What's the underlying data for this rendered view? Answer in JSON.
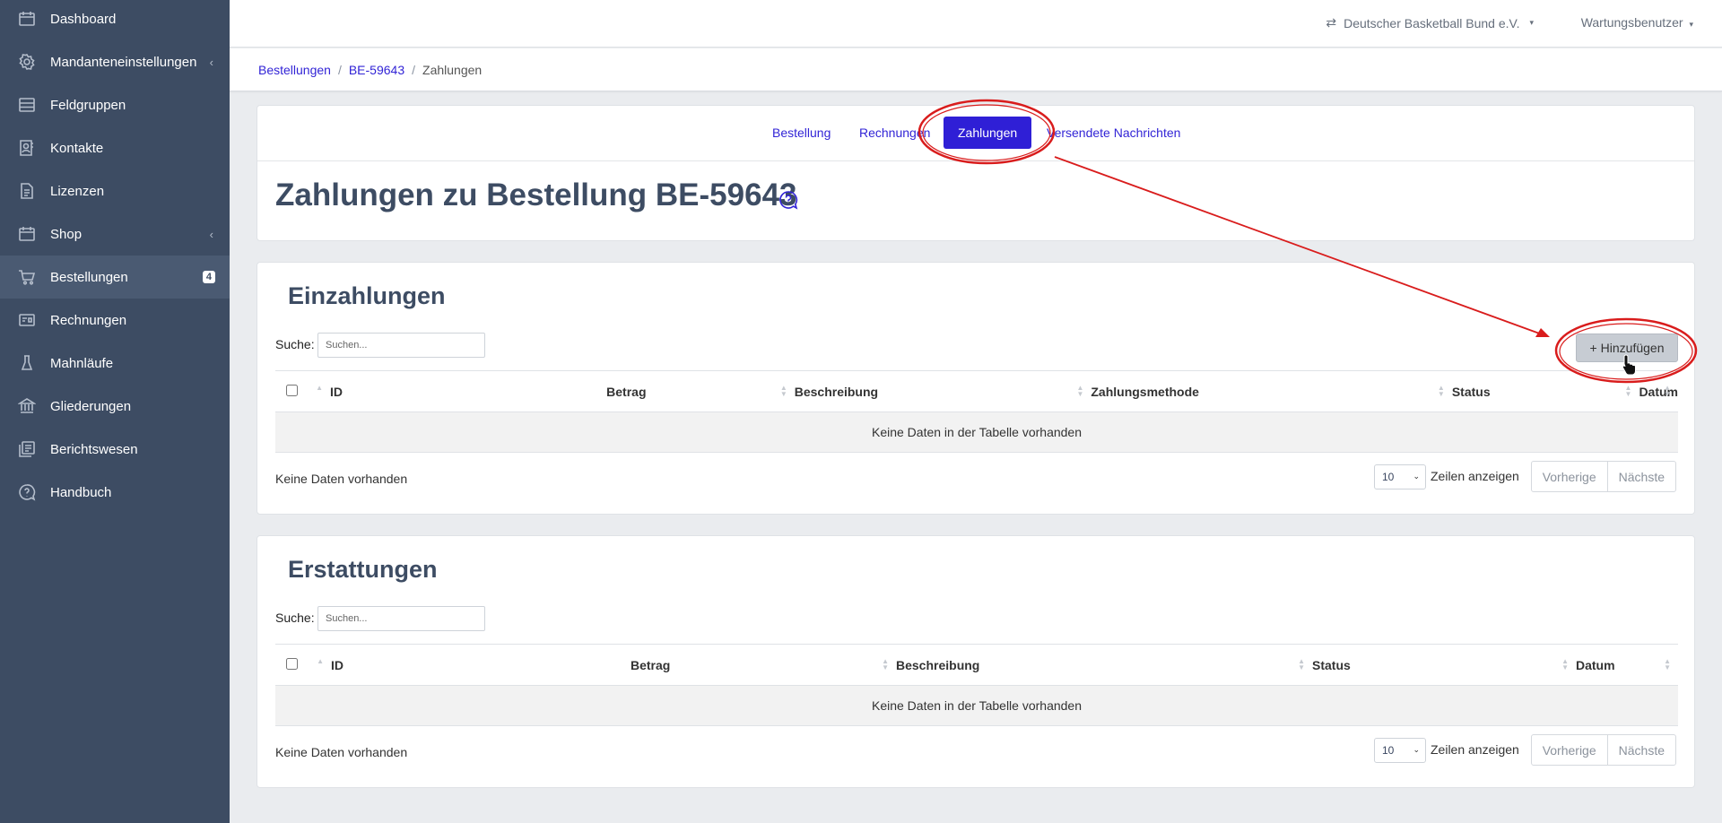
{
  "sidebar": {
    "items": [
      {
        "label": "Dashboard",
        "icon": "calendar-icon"
      },
      {
        "label": "Mandanteneinstellungen",
        "icon": "gear-icon",
        "chevron": "‹"
      },
      {
        "label": "Feldgruppen",
        "icon": "list-icon"
      },
      {
        "label": "Kontakte",
        "icon": "contact-icon"
      },
      {
        "label": "Lizenzen",
        "icon": "document-icon"
      },
      {
        "label": "Shop",
        "icon": "calendar-icon",
        "chevron": "‹"
      },
      {
        "label": "Bestellungen",
        "icon": "cart-icon",
        "badge": "4"
      },
      {
        "label": "Rechnungen",
        "icon": "receipt-icon"
      },
      {
        "label": "Mahnläufe",
        "icon": "flask-icon"
      },
      {
        "label": "Gliederungen",
        "icon": "bank-icon"
      },
      {
        "label": "Berichtswesen",
        "icon": "reports-icon"
      },
      {
        "label": "Handbuch",
        "icon": "help-icon"
      }
    ]
  },
  "topbar": {
    "tenant": "Deutscher Basketball Bund e.V.",
    "user": "Wartungsbenutzer",
    "caret": "▾",
    "switch_glyph": "⇄"
  },
  "breadcrumb": {
    "items": [
      "Bestellungen",
      "BE-59643",
      "Zahlungen"
    ],
    "separator": "/"
  },
  "tabs": [
    "Bestellung",
    "Rechnungen",
    "Zahlungen",
    "Versendete Nachrichten"
  ],
  "active_tab": "Zahlungen",
  "page_title": "Zahlungen zu Bestellung BE-59643",
  "einzahlungen": {
    "title": "Einzahlungen",
    "search_label": "Suche:",
    "search_placeholder": "Suchen...",
    "add_label": "Hinzufügen",
    "add_glyph": "+",
    "columns": [
      "ID",
      "Betrag",
      "Beschreibung",
      "Zahlungsmethode",
      "Status",
      "Datum"
    ],
    "empty_text": "Keine Daten in der Tabelle vorhanden",
    "info": "Keine Daten vorhanden",
    "page_length": "10",
    "length_label": "Zeilen anzeigen",
    "prev": "Vorherige",
    "next": "Nächste"
  },
  "erstattungen": {
    "title": "Erstattungen",
    "search_label": "Suche:",
    "search_placeholder": "Suchen...",
    "columns": [
      "ID",
      "Betrag",
      "Beschreibung",
      "Status",
      "Datum"
    ],
    "empty_text": "Keine Daten in der Tabelle vorhanden",
    "info": "Keine Daten vorhanden",
    "page_length": "10",
    "length_label": "Zeilen anzeigen",
    "prev": "Vorherige",
    "next": "Nächste"
  },
  "colors": {
    "sidebar_bg": "#3d4c63",
    "accent": "#2f1fd6",
    "annotation": "#d91c1c"
  }
}
